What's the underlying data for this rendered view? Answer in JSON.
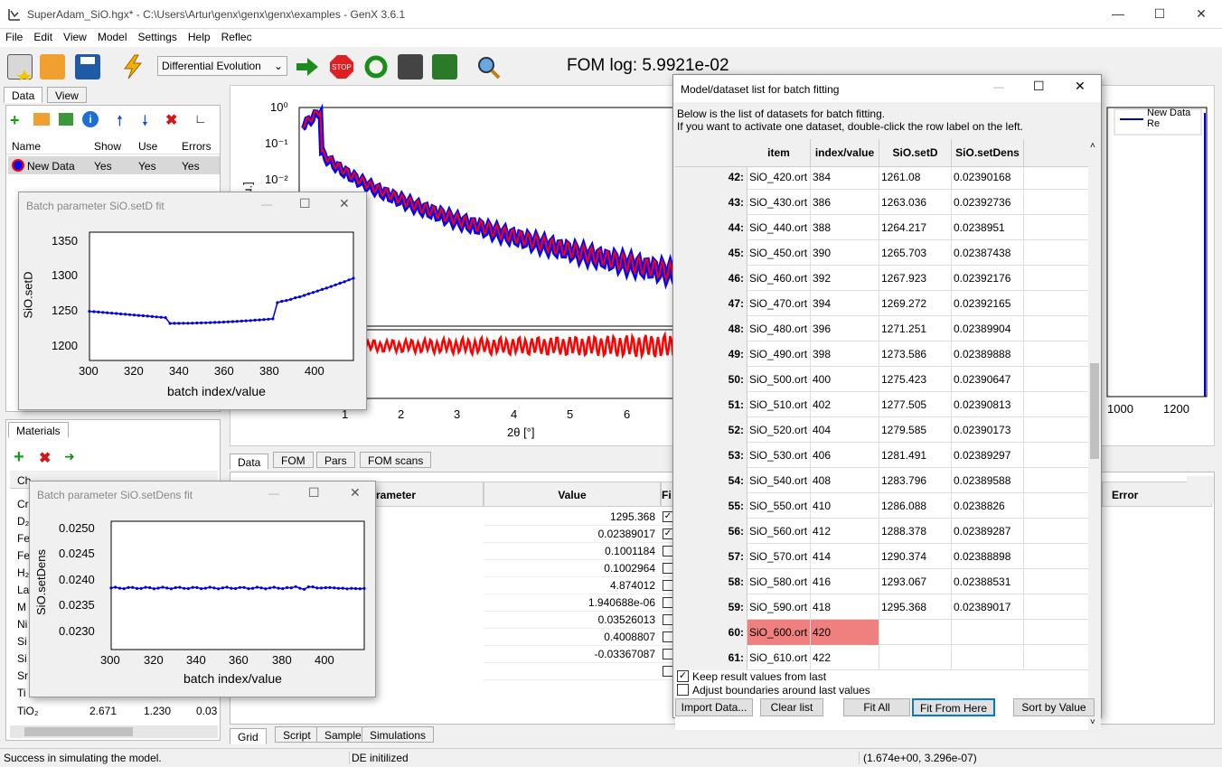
{
  "window": {
    "title": "SuperAdam_SiO.hgx* - C:\\Users\\Artur\\genx\\genx\\genx\\examples - GenX 3.6.1"
  },
  "menu": [
    "File",
    "Edit",
    "View",
    "Model",
    "Settings",
    "Help",
    "Reflec"
  ],
  "toolbar": {
    "algorithm": "Differential Evolution",
    "fom_text": "FOM log: 5.9921e-02"
  },
  "left_tabs": {
    "data": "Data",
    "view": "View"
  },
  "data_list": {
    "headers": [
      "Name",
      "Show",
      "Use",
      "Errors"
    ],
    "row": {
      "name": "New Data",
      "show": "Yes",
      "use": "Yes",
      "errors": "Yes"
    }
  },
  "materials": {
    "tab": "Materials",
    "rows": [
      {
        "name": "TiO₂",
        "a": "2.671",
        "b": "1.230",
        "c": "0.03"
      }
    ],
    "partial_labels": [
      "Cr",
      "D₂",
      "Fe",
      "Fe",
      "H₂",
      "La",
      "M",
      "Ni",
      "Si",
      "Si",
      "Sr",
      "Ti"
    ],
    "partial_header": "Ch"
  },
  "plot": {
    "xlabel": "2θ [°]",
    "ylabel_partial": "u.]",
    "y_ticks": [
      "10⁰",
      "10⁻¹",
      "10⁻²"
    ],
    "x_ticks": [
      "1",
      "2",
      "3",
      "4",
      "5",
      "6"
    ],
    "legend": [
      "New Data",
      "Re"
    ],
    "right_x_ticks": [
      "1000",
      "1200"
    ]
  },
  "plot_tabs": [
    "Data",
    "FOM",
    "Pars",
    "FOM scans"
  ],
  "bottom_tabs": [
    "Grid",
    "Script",
    "Sample",
    "Simulations"
  ],
  "param_grid": {
    "header_param": "rameter",
    "header_value": "Value",
    "header_fit": "Fi",
    "header_error": "Error",
    "values": [
      "1295.368",
      "0.02389017",
      "0.1001184",
      "0.1002964",
      "4.874012",
      "1.940688e-06",
      "0.03526013",
      "0.4008807",
      "-0.03367087"
    ],
    "checked": [
      true,
      true,
      false,
      false,
      false,
      false,
      false,
      false,
      false,
      false
    ]
  },
  "fit_setD": {
    "title": "Batch parameter SiO.setD fit",
    "ylabel": "SiO.setD",
    "xlabel": "batch index/value",
    "y_ticks": [
      "1350",
      "1300",
      "1250",
      "1200"
    ],
    "x_ticks": [
      "300",
      "320",
      "340",
      "360",
      "380",
      "400"
    ]
  },
  "fit_setDens": {
    "title": "Batch parameter SiO.setDens fit",
    "ylabel": "SiO.setDens",
    "xlabel": "batch index/value",
    "y_ticks": [
      "0.0250",
      "0.0245",
      "0.0240",
      "0.0235",
      "0.0230"
    ],
    "x_ticks": [
      "300",
      "320",
      "340",
      "360",
      "380",
      "400"
    ]
  },
  "batch": {
    "title": "Model/dataset list for batch fitting",
    "desc1": "Below is the list of datasets for batch fitting.",
    "desc2": "If you want to activate one dataset, double-click the row label on the left.",
    "headers": [
      "item",
      "index/value",
      "SiO.setD",
      "SiO.setDens"
    ],
    "rows": [
      [
        "42:",
        "SiO_420.ort",
        "384",
        "1261.08",
        "0.02390168"
      ],
      [
        "43:",
        "SiO_430.ort",
        "386",
        "1263.036",
        "0.02392736"
      ],
      [
        "44:",
        "SiO_440.ort",
        "388",
        "1264.217",
        "0.0238951"
      ],
      [
        "45:",
        "SiO_450.ort",
        "390",
        "1265.703",
        "0.02387438"
      ],
      [
        "46:",
        "SiO_460.ort",
        "392",
        "1267.923",
        "0.02392176"
      ],
      [
        "47:",
        "SiO_470.ort",
        "394",
        "1269.272",
        "0.02392165"
      ],
      [
        "48:",
        "SiO_480.ort",
        "396",
        "1271.251",
        "0.02389904"
      ],
      [
        "49:",
        "SiO_490.ort",
        "398",
        "1273.586",
        "0.02389888"
      ],
      [
        "50:",
        "SiO_500.ort",
        "400",
        "1275.423",
        "0.02390647"
      ],
      [
        "51:",
        "SiO_510.ort",
        "402",
        "1277.505",
        "0.02390813"
      ],
      [
        "52:",
        "SiO_520.ort",
        "404",
        "1279.585",
        "0.02390173"
      ],
      [
        "53:",
        "SiO_530.ort",
        "406",
        "1281.491",
        "0.02389297"
      ],
      [
        "54:",
        "SiO_540.ort",
        "408",
        "1283.796",
        "0.02389588"
      ],
      [
        "55:",
        "SiO_550.ort",
        "410",
        "1286.088",
        "0.0238826"
      ],
      [
        "56:",
        "SiO_560.ort",
        "412",
        "1288.378",
        "0.02389287"
      ],
      [
        "57:",
        "SiO_570.ort",
        "414",
        "1290.374",
        "0.02388898"
      ],
      [
        "58:",
        "SiO_580.ort",
        "416",
        "1293.067",
        "0.02388531"
      ],
      [
        "59:",
        "SiO_590.ort",
        "418",
        "1295.368",
        "0.02389017"
      ],
      [
        "60:",
        "SiO_600.ort",
        "420",
        "",
        ""
      ],
      [
        "61:",
        "SiO_610.ort",
        "422",
        "",
        ""
      ]
    ],
    "highlight_row": 18,
    "keep_label": "Keep result values from last",
    "adjust_label": "Adjust boundaries around last values",
    "buttons": [
      "Import Data...",
      "Clear list",
      "Fit All",
      "Fit From Here",
      "Sort by Value"
    ],
    "keep_checked": true,
    "adjust_checked": false
  },
  "status": {
    "left": "Success in simulating the model.",
    "mid": "DE initilized",
    "right": "(1.674e+00, 3.296e-07)"
  },
  "colors": {
    "accent_blue": "#0000ff",
    "accent_red": "#ff0000",
    "highlight": "#f08080"
  }
}
